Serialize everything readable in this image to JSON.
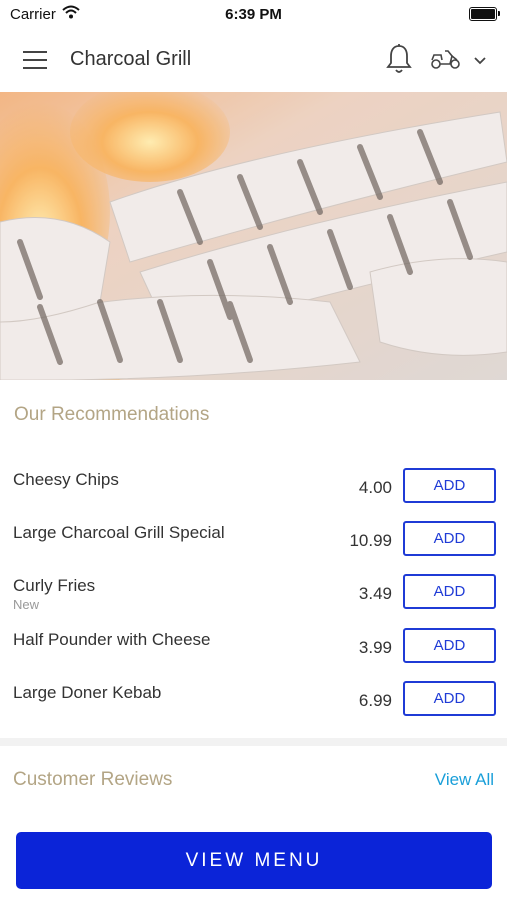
{
  "status_bar": {
    "carrier": "Carrier",
    "time": "6:39 PM"
  },
  "header": {
    "title": "Charcoal Grill",
    "icons": [
      "menu-icon",
      "bell-icon",
      "delivery-scooter-icon",
      "chevron-down-icon"
    ]
  },
  "hero": {
    "image": "grilled-chicken-flames-photo"
  },
  "recommendations": {
    "title": "Our Recommendations",
    "items": [
      {
        "name": "Cheesy Chips",
        "note": "",
        "price": "4.00",
        "button": "ADD"
      },
      {
        "name": "Large Charcoal Grill Special",
        "note": "",
        "price": "10.99",
        "button": "ADD"
      },
      {
        "name": "Curly Fries",
        "note": "New",
        "price": "3.49",
        "button": "ADD"
      },
      {
        "name": "Half Pounder with Cheese",
        "note": "",
        "price": "3.99",
        "button": "ADD"
      },
      {
        "name": "Large Doner Kebab",
        "note": "",
        "price": "6.99",
        "button": "ADD"
      }
    ]
  },
  "reviews": {
    "title": "Customer Reviews",
    "view_all": "View All"
  },
  "footer": {
    "button": "VIEW MENU"
  },
  "colors": {
    "accent_blue": "#0b24d8",
    "add_button_blue": "#1f3bd6",
    "section_title_gold": "#b3a585",
    "link_blue": "#1a9fd9"
  }
}
